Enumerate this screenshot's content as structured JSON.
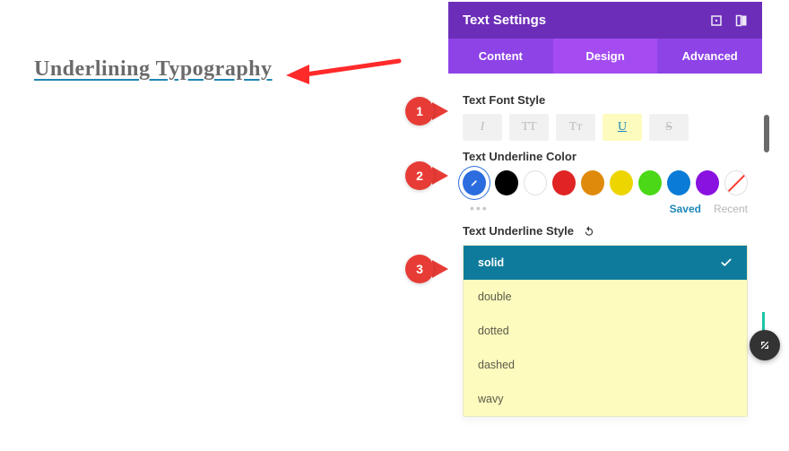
{
  "canvas": {
    "sample_text": "Underlining Typography"
  },
  "panel": {
    "title": "Text Settings",
    "tabs": {
      "content": "Content",
      "design": "Design",
      "advanced": "Advanced"
    },
    "sections": {
      "font_style": "Text Font Style",
      "underline_color": "Text Underline Color",
      "underline_style": "Text Underline Style"
    },
    "font_styles": {
      "italic": "I",
      "uppercase": "TT",
      "smallcaps": "Tᴛ",
      "underline": "U",
      "strike": "S"
    },
    "colors": {
      "picker": "#2b6cde",
      "swatches": [
        "#000000",
        "#ffffff",
        "#e02424",
        "#e08a0b",
        "#edd500",
        "#4bd817",
        "#0a7bd6",
        "#8a12e0"
      ]
    },
    "saved_label": "Saved",
    "recent_label": "Recent",
    "underline_styles": [
      "solid",
      "double",
      "dotted",
      "dashed",
      "wavy"
    ],
    "selected_underline_style": "solid"
  },
  "callouts": {
    "one": "1",
    "two": "2",
    "three": "3"
  }
}
